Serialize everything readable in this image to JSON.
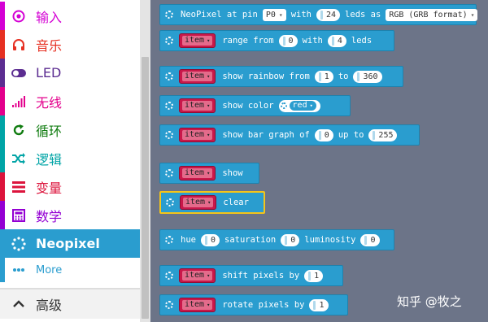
{
  "toolbox": {
    "categories": [
      {
        "label": "输入",
        "icon": "radio-target-icon",
        "color": "#d400d4"
      },
      {
        "label": "音乐",
        "icon": "headphones-icon",
        "color": "#e63022"
      },
      {
        "label": "LED",
        "icon": "toggle-icon",
        "color": "#5c2d91"
      },
      {
        "label": "无线",
        "icon": "signal-bars-icon",
        "color": "#e3008c"
      },
      {
        "label": "循环",
        "icon": "refresh-icon",
        "color": "#00a4a6"
      },
      {
        "label": "逻辑",
        "icon": "shuffle-icon",
        "color": "#00a4a6"
      },
      {
        "label": "变量",
        "icon": "lines-icon",
        "color": "#dc143c"
      },
      {
        "label": "数学",
        "icon": "calculator-icon",
        "color": "#9400d3"
      },
      {
        "label": "Neopixel",
        "icon": "spinner-icon",
        "color": "#2a9dcf"
      }
    ],
    "more_label": "More",
    "advanced_label": "高级"
  },
  "workspace": {
    "blocks": {
      "init": {
        "t1": "NeoPixel at pin",
        "pin": "P0",
        "t2": "with",
        "leds": "24",
        "t3": "leds as",
        "format": "RGB (GRB format)"
      },
      "range": {
        "var": "item",
        "t1": "range from",
        "from": "0",
        "t2": "with",
        "count": "4",
        "t3": "leds"
      },
      "rainbow": {
        "var": "item",
        "t1": "show rainbow from",
        "from": "1",
        "t2": "to",
        "to": "360"
      },
      "color": {
        "var": "item",
        "t1": "show color",
        "color": "red"
      },
      "bargraph": {
        "var": "item",
        "t1": "show bar graph of",
        "value": "0",
        "t2": "up to",
        "max": "255"
      },
      "show": {
        "var": "item",
        "t1": "show"
      },
      "clear": {
        "var": "item",
        "t1": "clear"
      },
      "hsl": {
        "t1": "hue",
        "hue": "0",
        "t2": "saturation",
        "sat": "0",
        "t3": "luminosity",
        "lum": "0"
      },
      "shift": {
        "var": "item",
        "t1": "shift pixels by",
        "n": "1"
      },
      "rotate": {
        "var": "item",
        "t1": "rotate pixels by",
        "n": "1"
      }
    }
  },
  "watermark": "知乎 @牧之"
}
